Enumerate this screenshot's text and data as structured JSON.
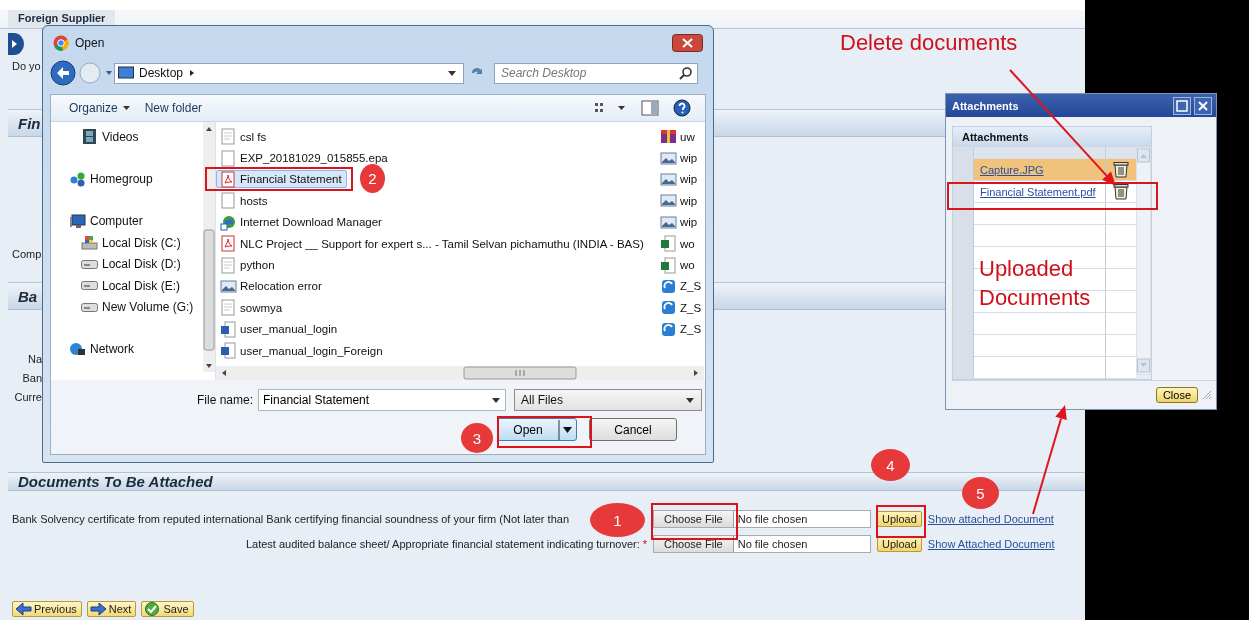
{
  "page": {
    "tab": "Foreign Supplier",
    "fragments": [
      {
        "kind": "text",
        "text": "Do yo"
      },
      {
        "kind": "header",
        "text": "Fin"
      },
      {
        "kind": "text",
        "text": "Comp"
      },
      {
        "kind": "header",
        "text": "Ba"
      },
      {
        "kind": "field-label",
        "text": "Na"
      },
      {
        "kind": "field-label",
        "text": "Ban"
      },
      {
        "kind": "field-label",
        "text": "Curre"
      }
    ],
    "documents": {
      "title": "Documents To Be Attached",
      "rows": [
        {
          "label": "Bank Solvency certificate from reputed international Bank certifying financial soundness of your firm (Not later than",
          "choose": "Choose File",
          "file": "No file chosen",
          "upload": "Upload",
          "link": "Show attached Document"
        },
        {
          "label": "Latest audited balance sheet/ Appropriate financial statement indicating turnover:",
          "required_mark": "*",
          "choose": "Choose File",
          "file": "No file chosen",
          "upload": "Upload",
          "link": "Show Attached Document"
        }
      ]
    },
    "nav_buttons": [
      {
        "label": "Previous",
        "kind": "back"
      },
      {
        "label": "Next",
        "kind": "forward"
      },
      {
        "label": "Save",
        "kind": "save"
      }
    ]
  },
  "open_dialog": {
    "title": "Open",
    "location": "Desktop",
    "search_placeholder": "Search Desktop",
    "toolbar": [
      "Organize",
      "New folder"
    ],
    "nav": [
      {
        "label": "Videos",
        "kind": "videos"
      },
      {
        "label": "Homegroup",
        "kind": "homegroup"
      },
      {
        "label": "Computer",
        "kind": "computer",
        "children": [
          {
            "label": "Local Disk (C:)",
            "kind": "system-disk"
          },
          {
            "label": "Local Disk (D:)",
            "kind": "disk"
          },
          {
            "label": "Local Disk (E:)",
            "kind": "disk"
          },
          {
            "label": "New Volume (G:)",
            "kind": "disk"
          }
        ]
      },
      {
        "label": "Network",
        "kind": "network"
      }
    ],
    "files": [
      {
        "name": "csl fs",
        "kind": "text",
        "selected": false
      },
      {
        "name": "EXP_20181029_015855.epa",
        "kind": "blank",
        "selected": false
      },
      {
        "name": "Financial Statement",
        "kind": "pdf",
        "selected": true
      },
      {
        "name": "hosts",
        "kind": "blank",
        "selected": false
      },
      {
        "name": "Internet Download Manager",
        "kind": "shortcut",
        "selected": false
      },
      {
        "name": "NLC Project __ Support for expert s... - Tamil Selvan pichamuthu (INDIA - BAS)",
        "kind": "pdf",
        "selected": false
      },
      {
        "name": "python",
        "kind": "text",
        "selected": false
      },
      {
        "name": "Relocation error",
        "kind": "image",
        "selected": false
      },
      {
        "name": "sowmya",
        "kind": "text",
        "selected": false
      },
      {
        "name": "user_manual_login",
        "kind": "word",
        "selected": false
      },
      {
        "name": "user_manual_login_Foreign",
        "kind": "word",
        "selected": false
      }
    ],
    "files_column_2": [
      {
        "name": "uw",
        "kind": "archive"
      },
      {
        "name": "wip",
        "kind": "image"
      },
      {
        "name": "wip",
        "kind": "image"
      },
      {
        "name": "wip",
        "kind": "image"
      },
      {
        "name": "wip",
        "kind": "image"
      },
      {
        "name": "wo",
        "kind": "excel"
      },
      {
        "name": "wo",
        "kind": "excel"
      },
      {
        "name": "Z_S",
        "kind": "app"
      },
      {
        "name": "Z_S",
        "kind": "app"
      },
      {
        "name": "Z_S",
        "kind": "app"
      }
    ],
    "file_name_label": "File name:",
    "file_name": "Financial Statement",
    "file_type": "All Files",
    "open_button": "Open",
    "cancel_button": "Cancel"
  },
  "attachments_window": {
    "title": "Attachments",
    "table_title": "Attachments",
    "rows": [
      {
        "name": "Capture.JPG",
        "selected": true
      },
      {
        "name": "Financial Statement.pdf",
        "selected": false
      }
    ],
    "close_button": "Close"
  },
  "annotations": {
    "labels": [
      {
        "kind": "delete",
        "text": "Delete documents"
      },
      {
        "kind": "uploaded",
        "text": "Uploaded Documents"
      }
    ],
    "steps": [
      "1",
      "2",
      "3",
      "4",
      "5"
    ]
  }
}
